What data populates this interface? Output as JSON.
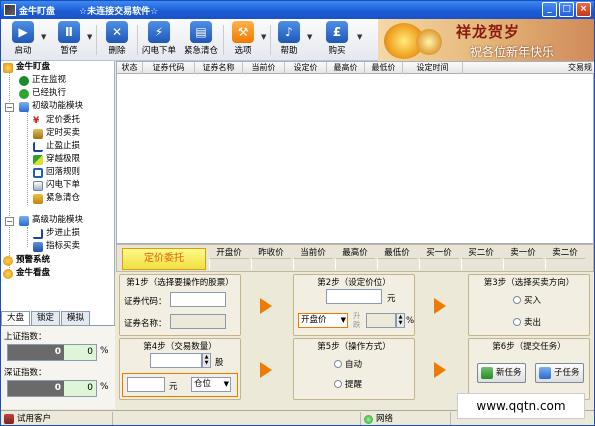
{
  "window": {
    "app_title": "金牛盯盘",
    "status_title": "☆未连接交易软件☆",
    "min": "_",
    "max": "□",
    "close": "×"
  },
  "toolbar": {
    "buttons": [
      {
        "label": "启动",
        "icon": "play-icon",
        "glyph": "▶"
      },
      {
        "label": "暂停",
        "icon": "pause-icon",
        "glyph": "Ⅱ"
      },
      {
        "label": "删除",
        "icon": "delete-icon",
        "glyph": "✕"
      },
      {
        "label": "闪电下单",
        "icon": "lightning-icon",
        "glyph": "⚡"
      },
      {
        "label": "紧急清仓",
        "icon": "chart-icon",
        "glyph": "▤"
      },
      {
        "label": "选项",
        "icon": "tools-icon",
        "glyph": "⚒"
      },
      {
        "label": "帮助",
        "icon": "help-icon",
        "glyph": "♪"
      },
      {
        "label": "购买",
        "icon": "pound-icon",
        "glyph": "£"
      }
    ]
  },
  "banner": {
    "line1": "祥龙贺岁",
    "line2": "祝各位新年快乐"
  },
  "sidebar": {
    "root": "金牛盯盘",
    "items": [
      {
        "label": "正在监视"
      },
      {
        "label": "已经执行"
      },
      {
        "label": "初级功能模块"
      },
      {
        "label": "定价委托"
      },
      {
        "label": "定时买卖"
      },
      {
        "label": "止盈止损"
      },
      {
        "label": "穿越极限"
      },
      {
        "label": "回落规则"
      },
      {
        "label": "闪电下单"
      },
      {
        "label": "紧急清仓"
      },
      {
        "label": "高级功能模块"
      },
      {
        "label": "步进止损"
      },
      {
        "label": "指标买卖"
      }
    ],
    "extra1": "预警系统",
    "extra2": "金牛看盘"
  },
  "tabs": [
    "大盘",
    "锁定",
    "模拟"
  ],
  "indices": {
    "sh_label": "上证指数：",
    "sh_value": "0",
    "sh_change": "0",
    "sz_label": "深证指数：",
    "sz_value": "0",
    "sz_change": "0",
    "pct": "%"
  },
  "grid": {
    "columns": [
      "状态",
      "证券代码",
      "证券名称",
      "当前价",
      "设定价",
      "最高价",
      "最低价",
      "设定时间",
      "交易规"
    ]
  },
  "quote": {
    "button": "定价委托",
    "headers": [
      "开盘价",
      "昨收价",
      "当前价",
      "最高价",
      "最低价",
      "买一价",
      "买二价",
      "卖一价",
      "卖二价"
    ]
  },
  "steps": {
    "s1_title": "第1步（选择要操作的股票）",
    "s1_code_label": "证券代码：",
    "s1_name_label": "证券名称：",
    "s2_title": "第2步（设定价位）",
    "s2_unit": "元",
    "s2_select": "开盘价",
    "s2_rise": "升",
    "s2_fall": "跌",
    "s2_pct": "%",
    "s3_title": "第3步（选择买卖方向）",
    "s3_buy": "买入",
    "s3_sell": "卖出",
    "s4_title": "第4步（交易数量）",
    "s4_unit_shares": "股",
    "s4_unit_yuan": "元",
    "s4_select": "仓位",
    "s5_title": "第5步（操作方式）",
    "s5_auto": "自动",
    "s5_remind": "提醒",
    "s6_title": "第6步（提交任务）",
    "s6_new": "新任务",
    "s6_sub": "子任务"
  },
  "status": {
    "user": "试用客户",
    "network": "网络"
  },
  "watermark": "www.qqtn.com"
}
